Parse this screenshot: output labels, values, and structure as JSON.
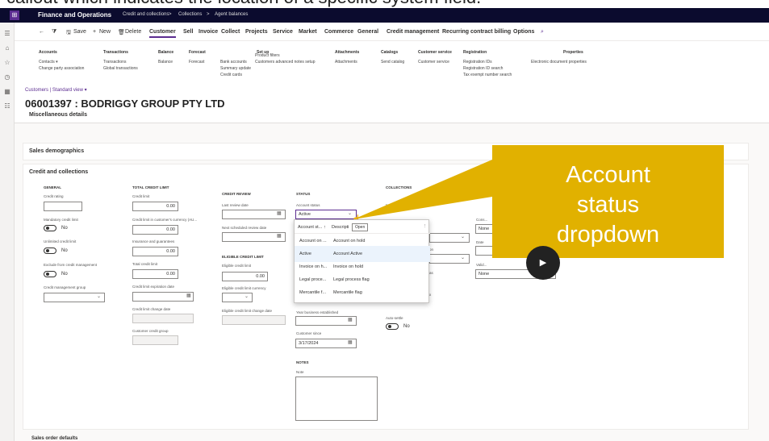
{
  "caption": {
    "text": "callout which indicates the location of a specific system field."
  },
  "topbar": {
    "app": "Finance and Operations",
    "crumbs": [
      "Credit and collections",
      ">",
      "Collections",
      ">",
      "Agent balances"
    ]
  },
  "toolbar": {
    "back": "←",
    "filter": "⧩",
    "save": "Save",
    "new": "New",
    "delete": "Delete",
    "tabs": [
      "Customer",
      "Sell",
      "Invoice",
      "Collect",
      "Projects",
      "Service",
      "Market",
      "Commerce",
      "General",
      "Credit management",
      "Recurring contract billing",
      "Options"
    ],
    "search": "⌕"
  },
  "ribbon": {
    "groups": [
      {
        "header": "Accounts",
        "items": [
          "Contacts ▾",
          "Change party association"
        ]
      },
      {
        "header": "Transactions",
        "items": [
          "Transactions",
          "Global transactions"
        ]
      },
      {
        "header": "Balance",
        "items": [
          "Balance"
        ]
      },
      {
        "header": "Forecast",
        "items": [
          "Forecast"
        ]
      },
      {
        "header": "Set up",
        "items": [
          "Bank accounts",
          "Summary update",
          "Credit cards"
        ]
      },
      {
        "header": "",
        "items": [
          "Product filters",
          "Customers advanced notes setup"
        ]
      },
      {
        "header": "Attachments",
        "items": [
          "Attachments"
        ]
      },
      {
        "header": "Catalogs",
        "items": [
          "Send catalog"
        ]
      },
      {
        "header": "Customer service",
        "items": [
          "Customer service"
        ]
      },
      {
        "header": "Registration",
        "items": [
          "Registration IDs",
          "Registration ID search",
          "Tax exempt number search"
        ]
      },
      {
        "header": "Properties",
        "items": [
          "Electronic document properties"
        ]
      }
    ]
  },
  "page": {
    "breadcrumb": "Customers  |  Standard view ▾",
    "title": "06001397 : BODRIGGY GROUP PTY LTD",
    "misc": "Miscellaneous details"
  },
  "sections": {
    "sales_demo": "Sales demographics",
    "credit": "Credit and collections",
    "sales_order": "Sales order defaults"
  },
  "general": {
    "h": "GENERAL",
    "credit_rating": "Credit rating",
    "mandatory": "Mandatory credit limit",
    "mandatory_val": "No",
    "unlimited": "Unlimited credit limit",
    "unlimited_val": "No",
    "exclude": "Exclude from credit management",
    "exclude_val": "No",
    "group": "Credit management group"
  },
  "total": {
    "h": "TOTAL CREDIT LIMIT",
    "credit_limit": "Credit limit",
    "credit_limit_val": "0.00",
    "currency": "Credit limit in customer's currency (AU...",
    "currency_val": "0.00",
    "insurance": "Insurance and guarantees",
    "insurance_val": "0.00",
    "total": "Total credit limit",
    "total_val": "0.00",
    "expiration": "Credit limit expiration date",
    "change": "Credit limit change date",
    "customer_group": "Customer credit group"
  },
  "review": {
    "h": "CREDIT REVIEW",
    "last": "Last review date",
    "next": "Next scheduled review date",
    "eligible_h": "ELIGIBLE CREDIT LIMIT",
    "eligible": "Eligible credit limit",
    "eligible_val": "0.00",
    "eligible_cur": "Eligible credit limit currency",
    "eligible_change": "Eligible credit limit change date"
  },
  "status": {
    "h": "STATUS",
    "account_status": "Account status",
    "account_status_val": "Active",
    "year": "Year business established",
    "since": "Customer since",
    "since_val": "3/17/2024",
    "notes_h": "NOTES",
    "note": "Note"
  },
  "collections": {
    "h": "COLLECTIONS",
    "invoicing": "Invoicing and d...",
    "auto": "Auto-settle",
    "auto_val": "No",
    "on": "on",
    "as": "as",
    "x": "x"
  },
  "col6": {
    "h": "COLL...",
    "none1": "None",
    "date": "Date",
    "valid": "Valid...",
    "none2": "None",
    "cnt": "Cons..."
  },
  "dropdown": {
    "col1": "Account st...",
    "sort": "↑",
    "col2": "Descripti",
    "open": "Open",
    "more": "⋮",
    "rows": [
      {
        "c1": "Account on ...",
        "c2": "Account on hold"
      },
      {
        "c1": "Active",
        "c2": "Account Active"
      },
      {
        "c1": "Invoice on h...",
        "c2": "Invoice on hold"
      },
      {
        "c1": "Legal proce...",
        "c2": "Legal process flag"
      },
      {
        "c1": "Mercantile f...",
        "c2": "Mercantile flag"
      }
    ]
  },
  "callout": {
    "l1": "Account",
    "l2": "status",
    "l3": "dropdown",
    "color": "#e1b100"
  },
  "play": {
    "icon": "▶"
  },
  "nav": {
    "icons": [
      "☰",
      "⌂",
      "☆",
      "◷",
      "▦",
      "☷"
    ]
  }
}
